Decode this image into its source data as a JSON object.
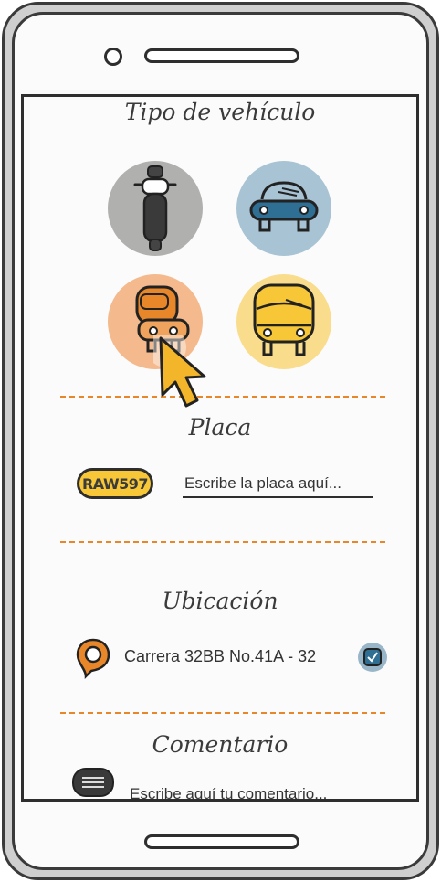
{
  "vehicle_section": {
    "title": "Tipo de vehículo",
    "options": [
      {
        "icon": "motorcycle-icon",
        "color": "#b0b0ae"
      },
      {
        "icon": "car-icon",
        "color": "#a8c4d4"
      },
      {
        "icon": "truck-icon",
        "color": "#f4b98c",
        "selected": true
      },
      {
        "icon": "bus-icon",
        "color": "#f9dc8c"
      }
    ]
  },
  "plate_section": {
    "title": "Placa",
    "badge": "RAW597",
    "placeholder": "Escribe la placa aquí..."
  },
  "location_section": {
    "title": "Ubicación",
    "address": "Carrera 32BB No.41A - 32",
    "confirmed": true
  },
  "comment_section": {
    "title": "Comentario",
    "placeholder": "Escribe aquí tu comentario..."
  },
  "colors": {
    "accent_orange": "#e8872a",
    "accent_yellow": "#f7c738",
    "accent_blue": "#2f6f93",
    "outline": "#2e2e2e"
  }
}
